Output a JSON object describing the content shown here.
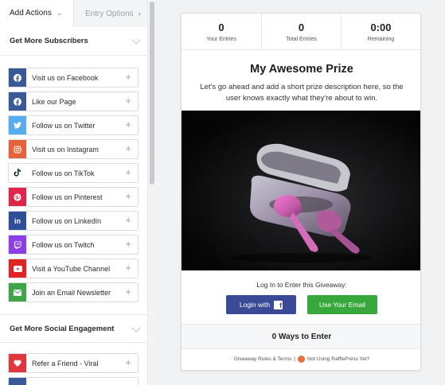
{
  "tabs": {
    "add_actions": "Add Actions",
    "entry_options": "Entry Options"
  },
  "sections": [
    {
      "title": "Get More Subscribers",
      "actions": [
        {
          "label": "Visit us on Facebook",
          "icon": "facebook-icon",
          "color": "#3b5998"
        },
        {
          "label": "Like our Page",
          "icon": "facebook-icon",
          "color": "#3b5998"
        },
        {
          "label": "Follow us on Twitter",
          "icon": "twitter-icon",
          "color": "#55acee"
        },
        {
          "label": "Visit us on Instagram",
          "icon": "instagram-icon",
          "color": "#e4633a"
        },
        {
          "label": "Follow us on TikTok",
          "icon": "tiktok-icon",
          "color": "#ffffff"
        },
        {
          "label": "Follow us on Pinterest",
          "icon": "pinterest-icon",
          "color": "#e0254b"
        },
        {
          "label": "Follow us on LinkedIn",
          "icon": "linkedin-icon",
          "color": "#2f4f9a"
        },
        {
          "label": "Follow us on Twitch",
          "icon": "twitch-icon",
          "color": "#8e3ee6"
        },
        {
          "label": "Visit a YouTube Channel",
          "icon": "youtube-icon",
          "color": "#e02424"
        },
        {
          "label": "Join an Email Newsletter",
          "icon": "email-icon",
          "color": "#3fa648"
        }
      ]
    },
    {
      "title": "Get More Social Engagement",
      "actions": [
        {
          "label": "Refer a Friend - Viral",
          "icon": "heart-icon",
          "color": "#e0373f"
        }
      ]
    }
  ],
  "stats": [
    {
      "value": "0",
      "caption": "Your Entries"
    },
    {
      "value": "0",
      "caption": "Total Entries"
    },
    {
      "value": "0:00",
      "caption": "Remaining"
    }
  ],
  "prize": {
    "title": "My Awesome Prize",
    "description": "Let's go ahead and add a short prize description here, so the user knows exactly what they're about to win."
  },
  "login": {
    "label": "Log In to Enter this Giveaway:",
    "facebook_button": "Login with",
    "email_button": "Use Your Email"
  },
  "ways_to_enter": "0 Ways to Enter",
  "footer": {
    "rules": "Giveaway Rules & Terms",
    "separator": "|",
    "promo": "Not Using RafflePress Yet?"
  },
  "colors": {
    "login_button": "#3b4a96",
    "email_button": "#38a83d"
  }
}
